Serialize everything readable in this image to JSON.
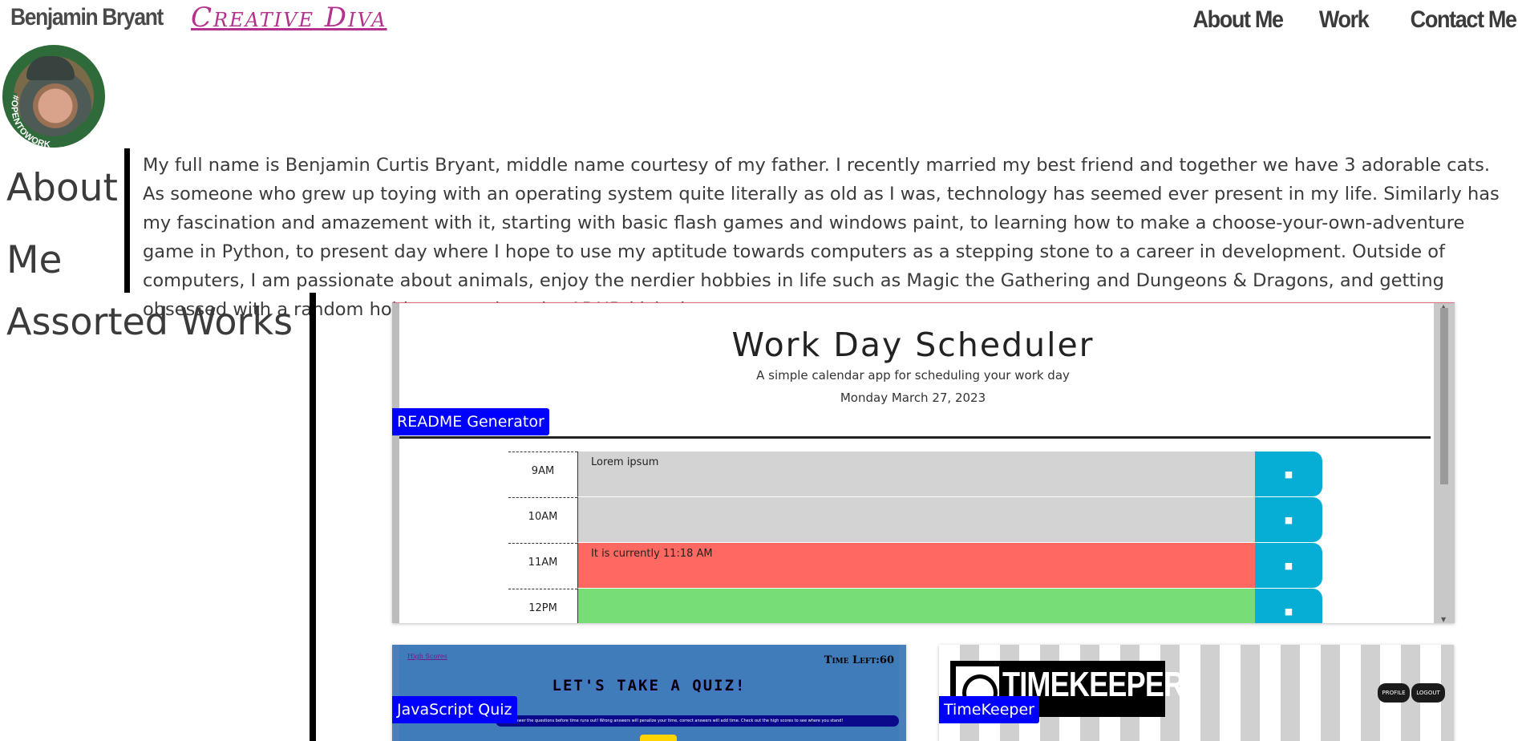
{
  "header": {
    "name": "Benjamin Bryant",
    "brand": "Creative Diva",
    "nav": [
      "About Me",
      "Work",
      "Contact Me"
    ]
  },
  "avatar": {
    "badge_text": "#OPENTOWORK",
    "ring_color": "#2f6b3a"
  },
  "about": {
    "heading": "About Me",
    "text": "My full name is Benjamin Curtis Bryant, middle name courtesy of my father. I recently married my best friend and together we have 3 adorable cats. As someone who grew up toying with an operating system quite literally as old as I was, technology has seemed ever present in my life. Similarly has my fascination and amazement with it, starting with basic flash games and windows paint, to learning how to make a choose-your-own-adventure game in Python, to present day where I hope to use my aptitude towards computers as a stepping stone to a career in development. Outside of computers, I am passionate about animals, enjoy the nerdier hobbies in life such as Magic the Gathering and Dungeons & Dragons, and getting obsessed with a random hobby every time the ADHD kicks in."
  },
  "works": {
    "heading": "Assorted Works",
    "scheduler": {
      "label": "README Generator",
      "title": "Work Day Scheduler",
      "subtitle": "A simple calendar app for scheduling your work day",
      "date": "Monday March 27, 2023",
      "rows": [
        {
          "hour": "9AM",
          "text": "Lorem ipsum",
          "color": "#d3d3d3"
        },
        {
          "hour": "10AM",
          "text": "",
          "color": "#d3d3d3"
        },
        {
          "hour": "11AM",
          "text": "It is currently 11:18 AM",
          "color": "#ff6961"
        },
        {
          "hour": "12PM",
          "text": "",
          "color": "#77dd77"
        }
      ],
      "save_icon": "floppy-disk-icon"
    },
    "quiz": {
      "label": "JavaScript Quiz",
      "high_scores": "High Scores",
      "time_left": "Time Left:60",
      "title": "LET'S TAKE A QUIZ!",
      "instructions": "Try to answer the questions before time runs out! Wrong answers will penalize your time, correct answers will add time. Check out the high scores to see where you stand!"
    },
    "timekeeper": {
      "label": "TimeKeeper",
      "logo_text": "TIMEKEEPER",
      "profile_btn": "PROFILE",
      "logout_btn": "LOGOUT"
    }
  }
}
